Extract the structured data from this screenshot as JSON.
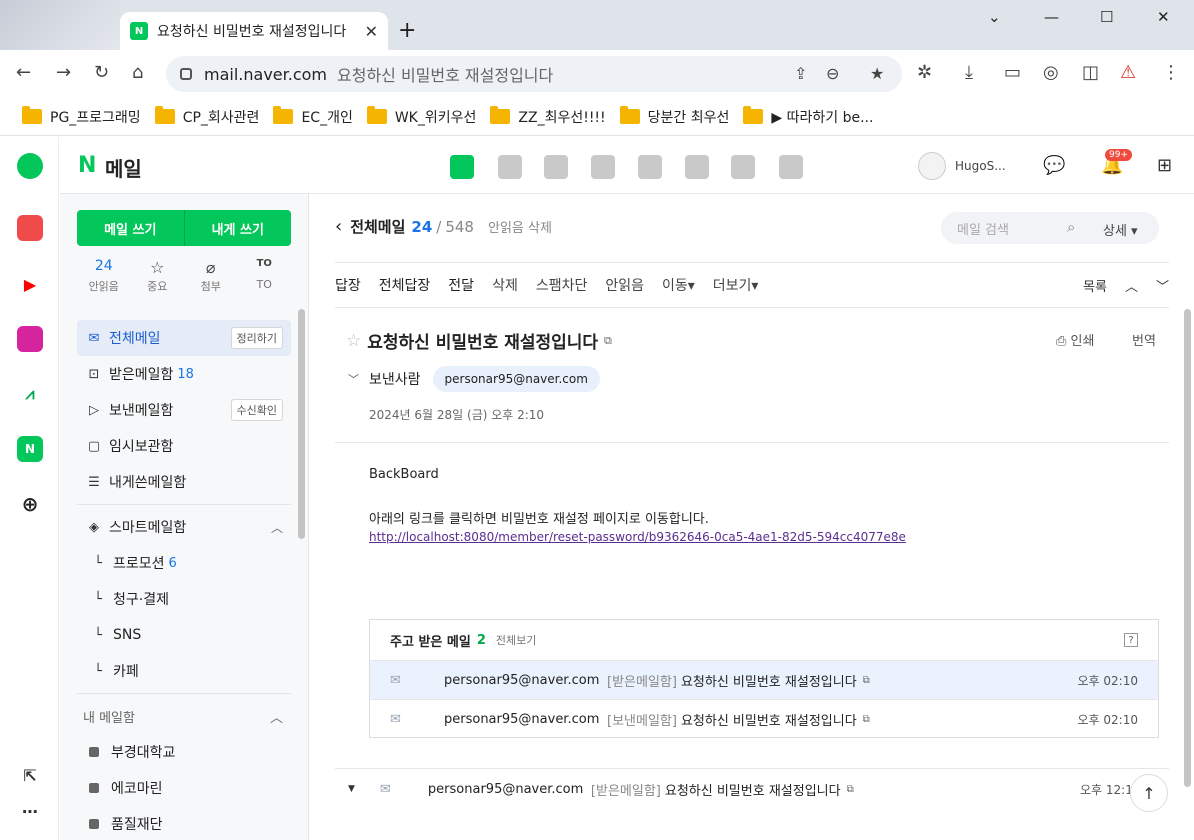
{
  "browser": {
    "tab_title": "요청하신 비밀번호 재설정입니다",
    "tab_favicon": "N",
    "url_host": "mail.naver.com",
    "url_page": "요청하신 비밀번호 재설정입니다",
    "bookmarks": [
      "PG_프로그래밍",
      "CP_회사관련",
      "EC_개인",
      "WK_위키우선",
      "ZZ_최우선!!!!",
      "당분간 최우선",
      "▶ 따라하기 be..."
    ]
  },
  "header": {
    "logo_n": "N",
    "logo_text": "메일",
    "user_name": "HugoS...",
    "notif_badge": "99+"
  },
  "sidebar": {
    "write_mail": "메일 쓰기",
    "write_self": "내게 쓰기",
    "quick": [
      {
        "value": "24",
        "label": "안읽음"
      },
      {
        "value": "☆",
        "label": "중요"
      },
      {
        "value": "⌀",
        "label": "첨부"
      },
      {
        "value": "TO",
        "label": "TO"
      }
    ],
    "folders": [
      {
        "label": "전체메일",
        "tag": "정리하기"
      },
      {
        "label": "받은메일함",
        "count": "18"
      },
      {
        "label": "보낸메일함",
        "tag": "수신확인"
      },
      {
        "label": "임시보관함"
      },
      {
        "label": "내게쓴메일함"
      }
    ],
    "smart_title": "스마트메일함",
    "smart": [
      {
        "label": "프로모션",
        "count": "6"
      },
      {
        "label": "청구·결제"
      },
      {
        "label": "SNS"
      },
      {
        "label": "카페"
      }
    ],
    "my_title": "내 메일함",
    "my": [
      "부경대학교",
      "에코마린",
      "품질재단"
    ]
  },
  "main": {
    "title": "전체메일",
    "unread": "24",
    "slash": "/",
    "total": "548",
    "delete_unread": "안읽음 삭제",
    "search_placeholder": "메일 검색",
    "advanced": "상세 ▾",
    "actions": [
      "답장",
      "전체답장",
      "전달",
      "삭제",
      "스팸차단",
      "안읽음",
      "이동▾",
      "더보기▾"
    ],
    "list_label": "목록",
    "subject": "요청하신 비밀번호 재설정입니다",
    "print": "인쇄",
    "translate": "번역",
    "sender_label": "보낸사람",
    "sender": "personar95@naver.com",
    "date": "2024년 6월 28일 (금) 오후 2:10",
    "body_line1": "BackBoard",
    "body_line2": "아래의 링크를 클릭하면 비밀번호 재설정 페이지로 이동합니다.",
    "body_link": "http://localhost:8080/member/reset-password/b9362646-0ca5-4ae1-82d5-594cc4077e8e",
    "convo_title": "주고 받은 메일",
    "convo_count": "2",
    "convo_all": "전체보기",
    "convo_rows": [
      {
        "from": "personar95@naver.com",
        "box": "[받은메일함]",
        "subject": "요청하신 비밀번호 재설정입니다",
        "time": "오후 02:10"
      },
      {
        "from": "personar95@naver.com",
        "box": "[보낸메일함]",
        "subject": "요청하신 비밀번호 재설정입니다",
        "time": "오후 02:10"
      }
    ],
    "bottom_row": {
      "from": "personar95@naver.com",
      "box": "[받은메일함]",
      "subject": "요청하신 비밀번호 재설정입니다",
      "time": "오후 12:1"
    }
  },
  "colors": {
    "brand": "#03c75a",
    "accent": "#1a73e8",
    "selected_bg": "#e5ebf7"
  }
}
